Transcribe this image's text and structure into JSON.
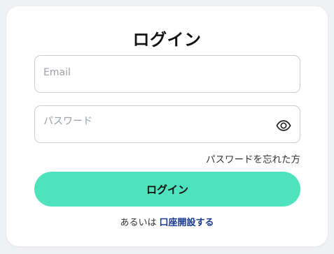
{
  "login": {
    "title": "ログイン",
    "email_placeholder": "Email",
    "password_placeholder": "パスワード",
    "forgot_password_label": "パスワードを忘れた方",
    "submit_label": "ログイン",
    "alternative_prefix": "あるいは",
    "open_account_label": "口座開設する",
    "show_password_icon": "eye-icon"
  },
  "colors": {
    "background": "#eef0f4",
    "card": "#ffffff",
    "button": "#4fe3bd",
    "link": "#1a3a8f"
  }
}
